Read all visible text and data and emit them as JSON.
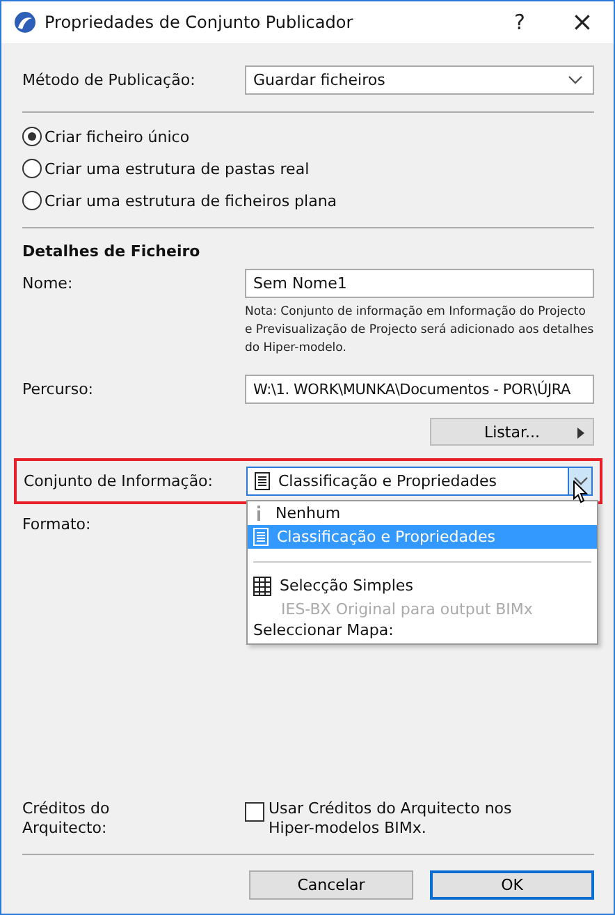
{
  "window": {
    "title": "Propriedades de Conjunto Publicador",
    "help": "?",
    "close": "×"
  },
  "method": {
    "label": "Método de Publicação:",
    "value": "Guardar ficheiros"
  },
  "radios": [
    {
      "label": "Criar ficheiro único",
      "selected": true
    },
    {
      "label": "Criar uma estrutura de pastas real",
      "selected": false
    },
    {
      "label": "Criar uma estrutura de ficheiros plana",
      "selected": false
    }
  ],
  "details": {
    "heading": "Detalhes de Ficheiro",
    "name_label": "Nome:",
    "name_value": "Sem Nome1",
    "note": "Nota: Conjunto de informação em Informação do Projecto e Previsualização de Projecto será adicionado aos detalhes do Hiper-modelo.",
    "path_label": "Percurso:",
    "path_value": "W:\\1. WORK\\MUNKA\\Documentos - POR\\ÚJRA",
    "list_button": "Listar..."
  },
  "info_set": {
    "label": "Conjunto de Informação:",
    "value": "Classificação e Propriedades",
    "highlighted": true,
    "expanded": true
  },
  "dropdown": [
    {
      "kind": "none",
      "label": "Nenhum",
      "selected": false,
      "disabled": false
    },
    {
      "kind": "document",
      "label": "Classificação e Propriedades",
      "selected": true,
      "disabled": false
    },
    {
      "kind": "separator"
    },
    {
      "kind": "grid",
      "label": "Selecção Simples",
      "selected": false,
      "disabled": false
    },
    {
      "kind": "note",
      "label": "IES-BX Original para output BIMx",
      "selected": false,
      "disabled": true
    },
    {
      "kind": "heading",
      "label": "Seleccionar Mapa:",
      "selected": false,
      "disabled": false
    }
  ],
  "format": {
    "label": "Formato:"
  },
  "credits": {
    "label": "Créditos do Arquitecto:",
    "checkbox_label": "Usar Créditos do Arquitecto nos Hiper-modelos BIMx.",
    "checked": false
  },
  "buttons": [
    {
      "label": "Cancelar",
      "default": false
    },
    {
      "label": "OK",
      "default": true
    }
  ]
}
